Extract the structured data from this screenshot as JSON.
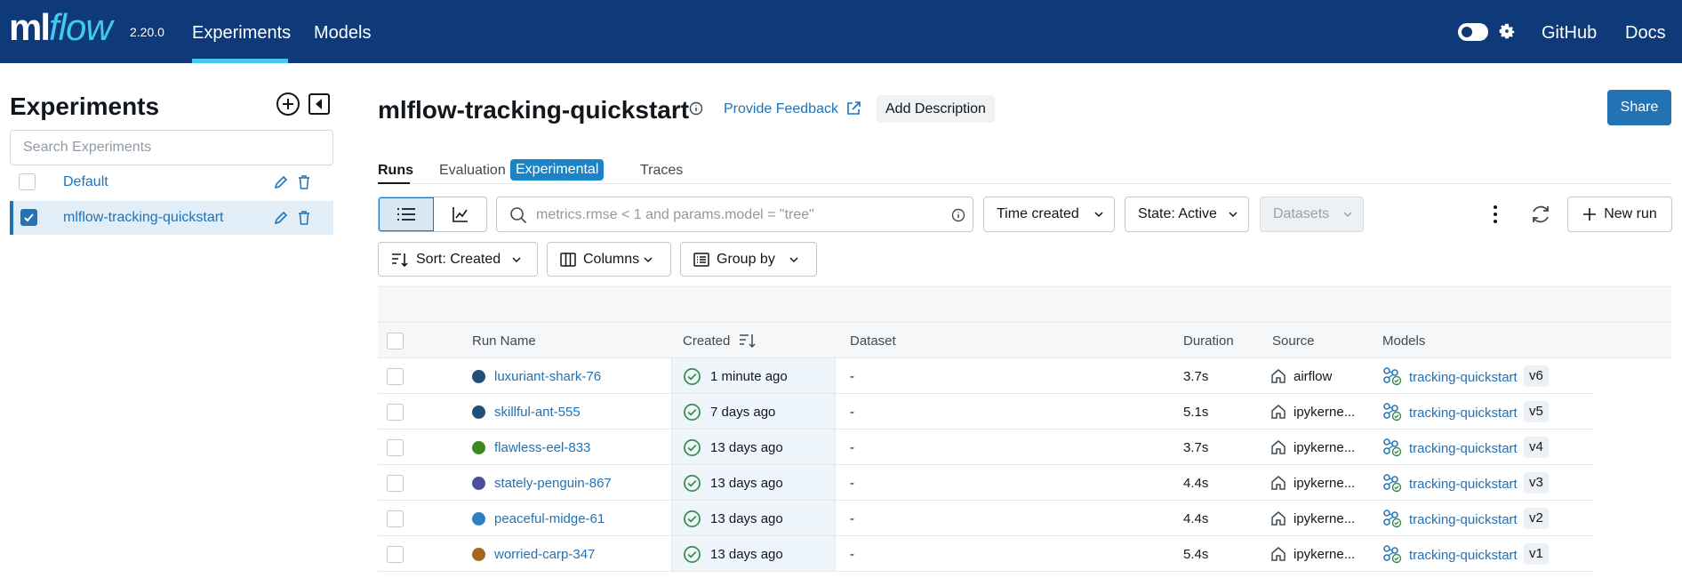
{
  "topbar": {
    "logo_ml": "ml",
    "logo_flow": "flow",
    "version": "2.20.0",
    "nav": [
      "Experiments",
      "Models"
    ],
    "links": [
      "GitHub",
      "Docs"
    ]
  },
  "sidebar": {
    "title": "Experiments",
    "search_placeholder": "Search Experiments",
    "experiments": [
      {
        "name": "Default",
        "checked": false
      },
      {
        "name": "mlflow-tracking-quickstart",
        "checked": true
      }
    ]
  },
  "header": {
    "title": "mlflow-tracking-quickstart",
    "feedback": "Provide Feedback",
    "add_description": "Add Description",
    "share": "Share"
  },
  "tabs": {
    "runs": "Runs",
    "evaluation": "Evaluation",
    "experimental": "Experimental",
    "traces": "Traces"
  },
  "toolbar": {
    "search_placeholder": "metrics.rmse < 1 and params.model = \"tree\"",
    "time_created": "Time created",
    "state": "State: Active",
    "datasets": "Datasets",
    "new_run": "New run",
    "sort": "Sort: Created",
    "columns": "Columns",
    "group_by": "Group by"
  },
  "table": {
    "headers": {
      "run_name": "Run Name",
      "created": "Created",
      "dataset": "Dataset",
      "duration": "Duration",
      "source": "Source",
      "models": "Models"
    },
    "rows": [
      {
        "name": "luxuriant-shark-76",
        "color": "#1f4e79",
        "created": "1 minute ago",
        "dataset": "-",
        "duration": "3.7s",
        "source": "airflow",
        "model": "tracking-quickstart",
        "version": "v6"
      },
      {
        "name": "skillful-ant-555",
        "color": "#1f4e79",
        "created": "7 days ago",
        "dataset": "-",
        "duration": "5.1s",
        "source": "ipykerne...",
        "model": "tracking-quickstart",
        "version": "v5"
      },
      {
        "name": "flawless-eel-833",
        "color": "#3a8a1e",
        "created": "13 days ago",
        "dataset": "-",
        "duration": "3.7s",
        "source": "ipykerne...",
        "model": "tracking-quickstart",
        "version": "v4"
      },
      {
        "name": "stately-penguin-867",
        "color": "#4b4f9e",
        "created": "13 days ago",
        "dataset": "-",
        "duration": "4.4s",
        "source": "ipykerne...",
        "model": "tracking-quickstart",
        "version": "v3"
      },
      {
        "name": "peaceful-midge-61",
        "color": "#2f7fc4",
        "created": "13 days ago",
        "dataset": "-",
        "duration": "4.4s",
        "source": "ipykerne...",
        "model": "tracking-quickstart",
        "version": "v2"
      },
      {
        "name": "worried-carp-347",
        "color": "#a8661a",
        "created": "13 days ago",
        "dataset": "-",
        "duration": "5.4s",
        "source": "ipykerne...",
        "model": "tracking-quickstart",
        "version": "v1"
      }
    ]
  },
  "colors": {
    "topbar": "#0e3a7a",
    "accent": "#43c9ed",
    "primary": "#2272b4",
    "success": "#3a8a4a"
  }
}
